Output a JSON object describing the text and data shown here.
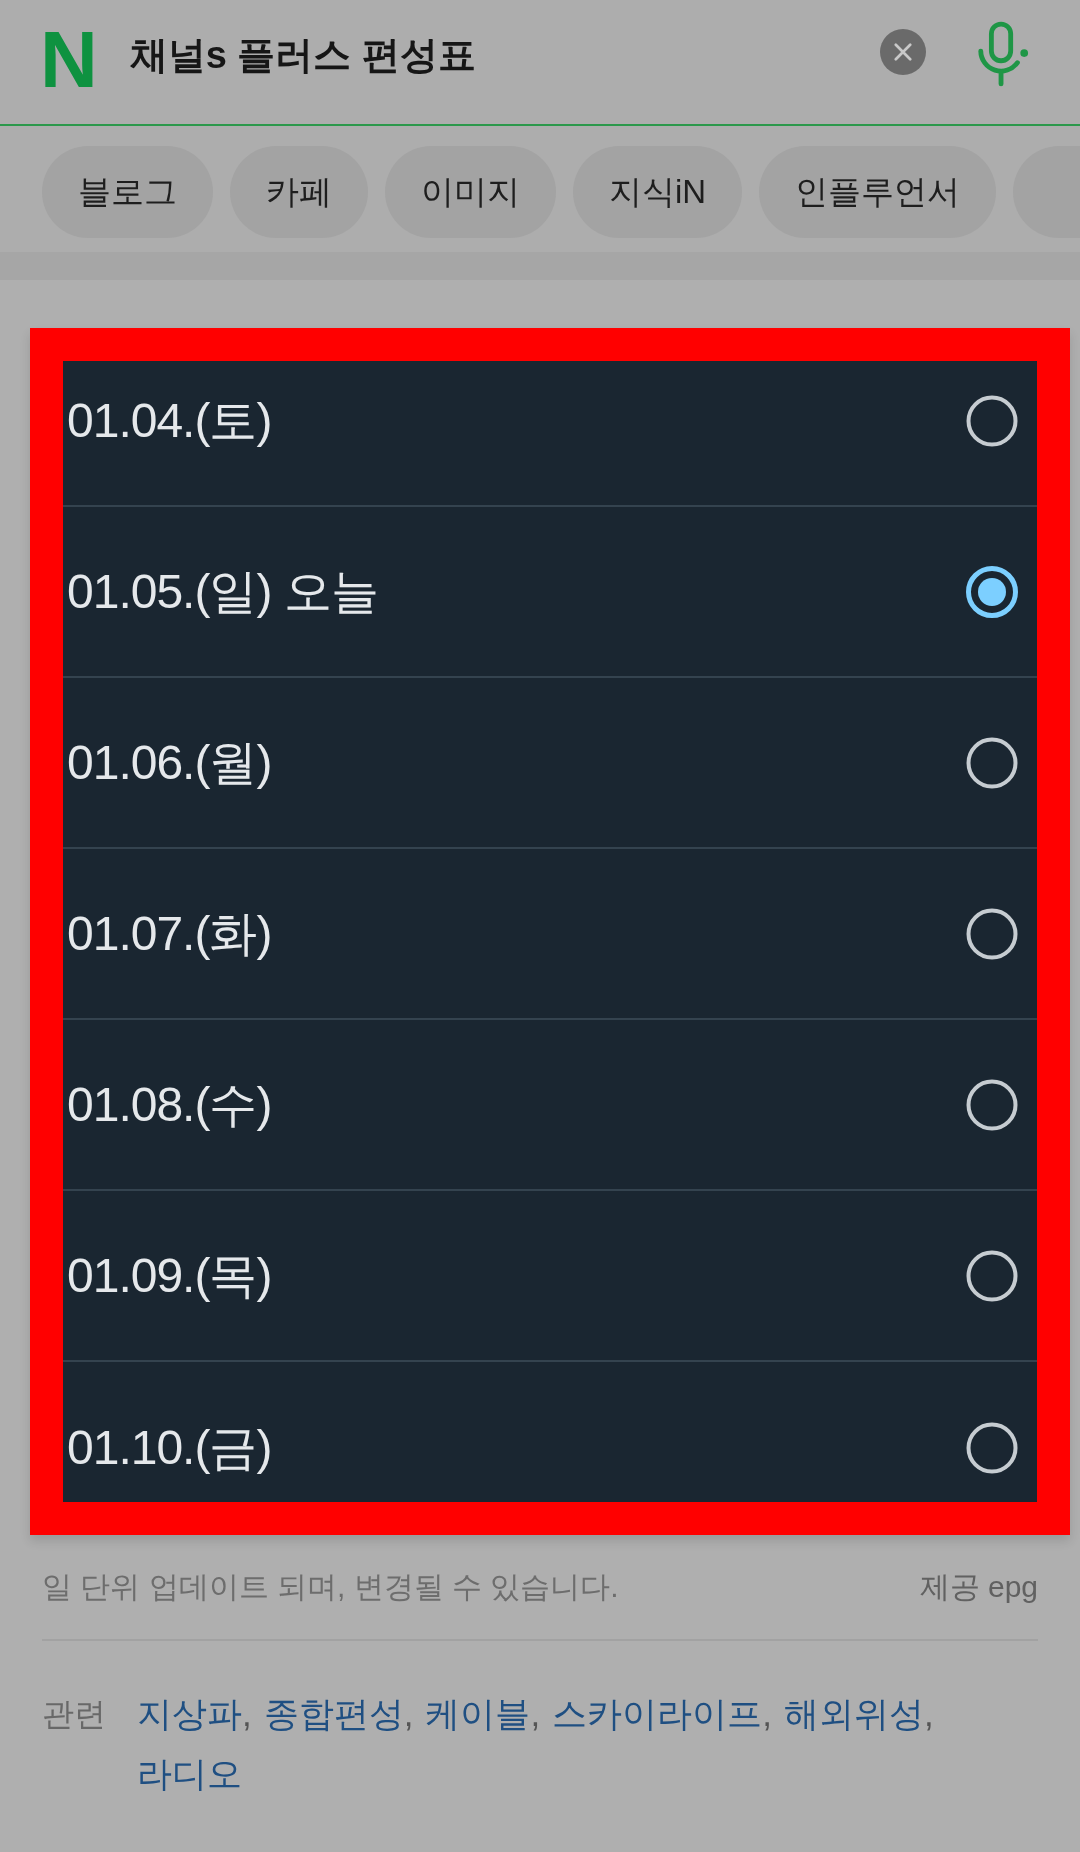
{
  "search_bar": {
    "logo": "N",
    "query": "채널s 플러스 편성표"
  },
  "category_chips": [
    {
      "kind": "chip",
      "label": "블로그"
    },
    {
      "kind": "chip",
      "label": "카페"
    },
    {
      "kind": "chip",
      "label": "이미지"
    },
    {
      "kind": "chip",
      "label": "지식iN"
    },
    {
      "kind": "chip",
      "label": "인플루언서"
    },
    {
      "kind": "clipped"
    }
  ],
  "date_dialog": {
    "options": [
      {
        "label": "01.04.(토)",
        "selected": false
      },
      {
        "label": "01.05.(일) 오늘",
        "selected": true
      },
      {
        "label": "01.06.(월)",
        "selected": false
      },
      {
        "label": "01.07.(화)",
        "selected": false
      },
      {
        "label": "01.08.(수)",
        "selected": false
      },
      {
        "label": "01.09.(목)",
        "selected": false
      },
      {
        "label": "01.10.(금)",
        "selected": false
      }
    ]
  },
  "footer": {
    "notice": "일 단위 업데이트 되며, 변경될 수 있습니다.",
    "provider": "제공 epg"
  },
  "related": {
    "label": "관련",
    "separator": ",",
    "links": [
      "지상파",
      "종합편성",
      "케이블",
      "스카이라이프",
      "해외위성",
      "라디오"
    ]
  }
}
